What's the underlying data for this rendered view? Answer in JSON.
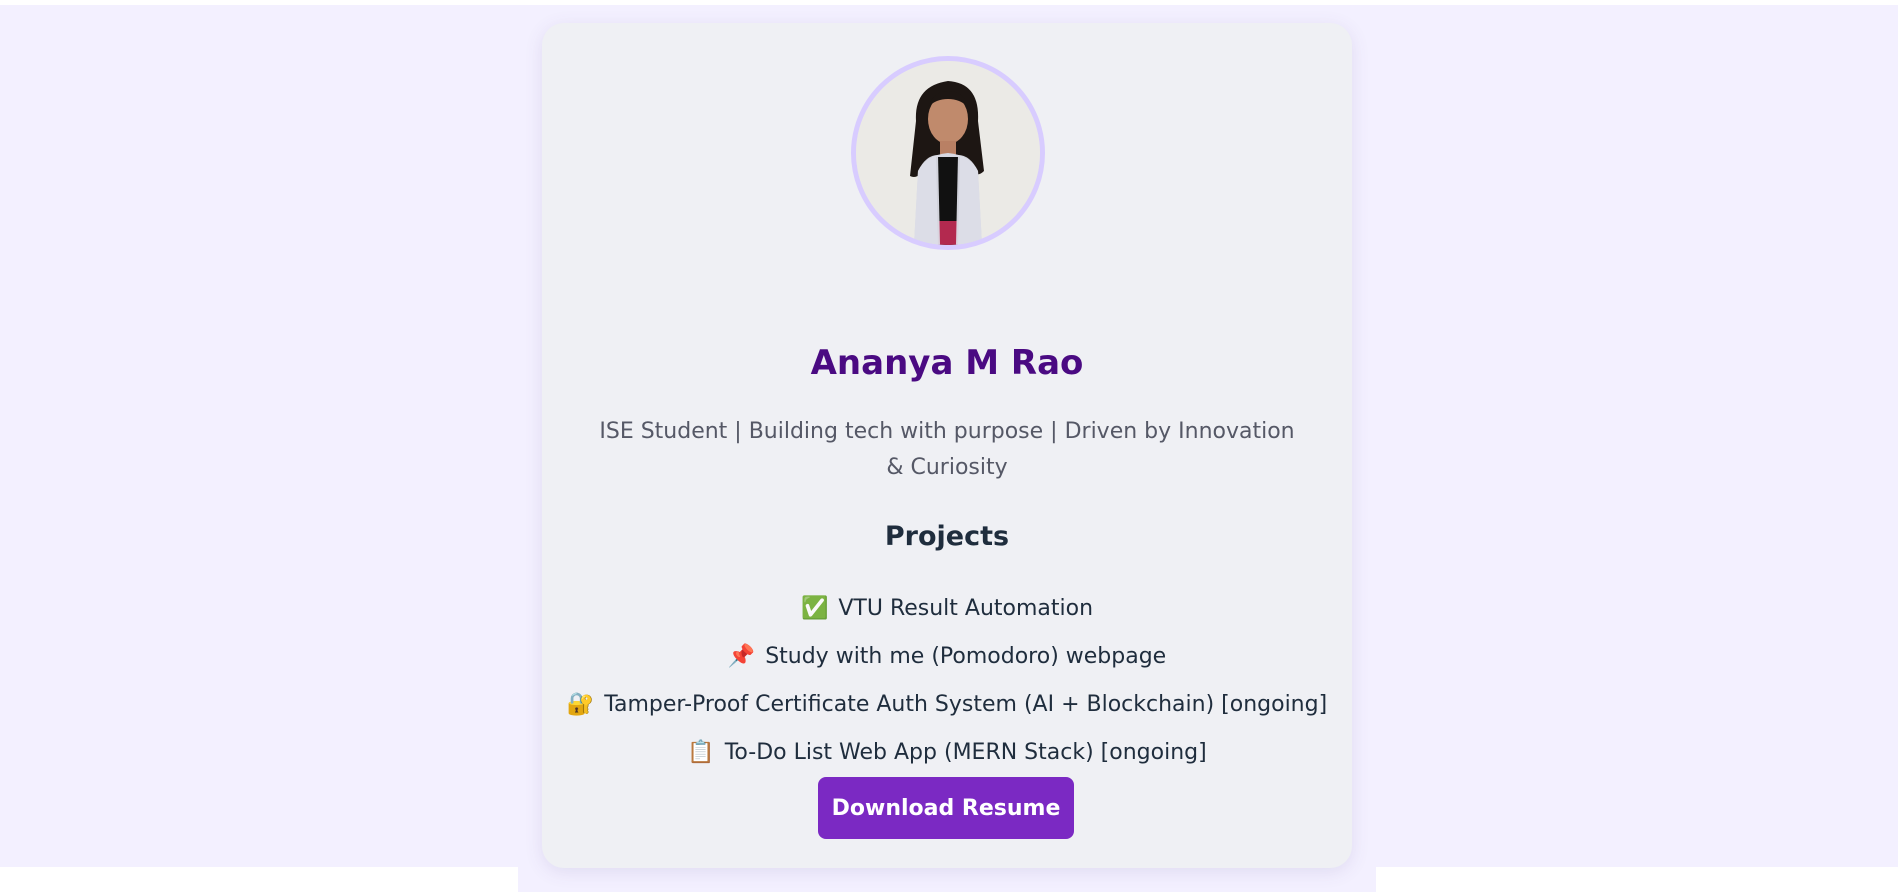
{
  "profile": {
    "name": "Ananya M Rao",
    "tagline": "ISE Student | Building tech with purpose | Driven by Innovation & Curiosity",
    "avatar_alt": "Ananya M Rao profile photo"
  },
  "projects": {
    "heading": "Projects",
    "items": [
      {
        "icon": "check-mark-icon",
        "glyph": "✅",
        "label": "VTU Result Automation"
      },
      {
        "icon": "pushpin-icon",
        "glyph": "📌",
        "label": "Study with me (Pomodoro) webpage"
      },
      {
        "icon": "lock-icon",
        "glyph": "🔐",
        "label": "Tamper-Proof Certificate Auth System (AI + Blockchain) [ongoing]"
      },
      {
        "icon": "clipboard-icon",
        "glyph": "📋",
        "label": "To-Do List Web App (MERN Stack) [ongoing]"
      }
    ]
  },
  "actions": {
    "download_label": "Download Resume"
  },
  "colors": {
    "page_background": "#f3f0ff",
    "card_background": "#eff0f4",
    "name_color": "#4a0a82",
    "button_color": "#7b29c3",
    "avatar_ring": "#d8ccff"
  }
}
